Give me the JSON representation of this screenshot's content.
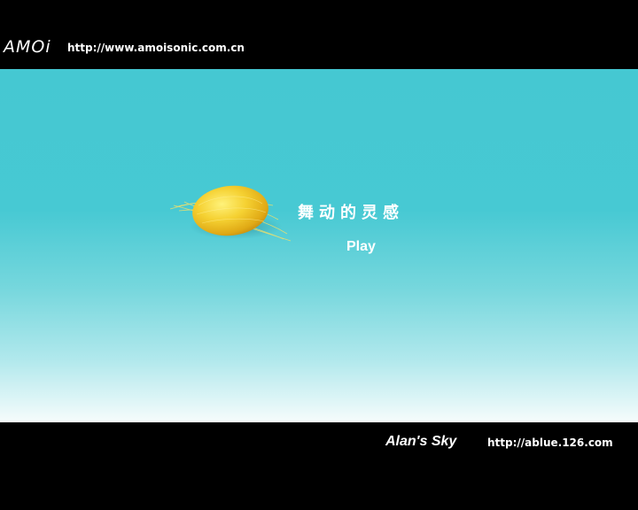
{
  "header": {
    "logo_text": "AMOi",
    "url": "http://www.amoisonic.com.cn"
  },
  "main": {
    "title": "舞动的灵感",
    "play_label": "Play",
    "cocoon_icon": "silk-cocoon-icon"
  },
  "footer": {
    "signature": "Alan's Sky",
    "url": "http://ablue.126.com"
  },
  "colors": {
    "bar": "#000000",
    "sky_top": "#45c8d2",
    "sky_bottom": "#f6fcfc",
    "cocoon": "#f2c62a",
    "text": "#ffffff"
  }
}
